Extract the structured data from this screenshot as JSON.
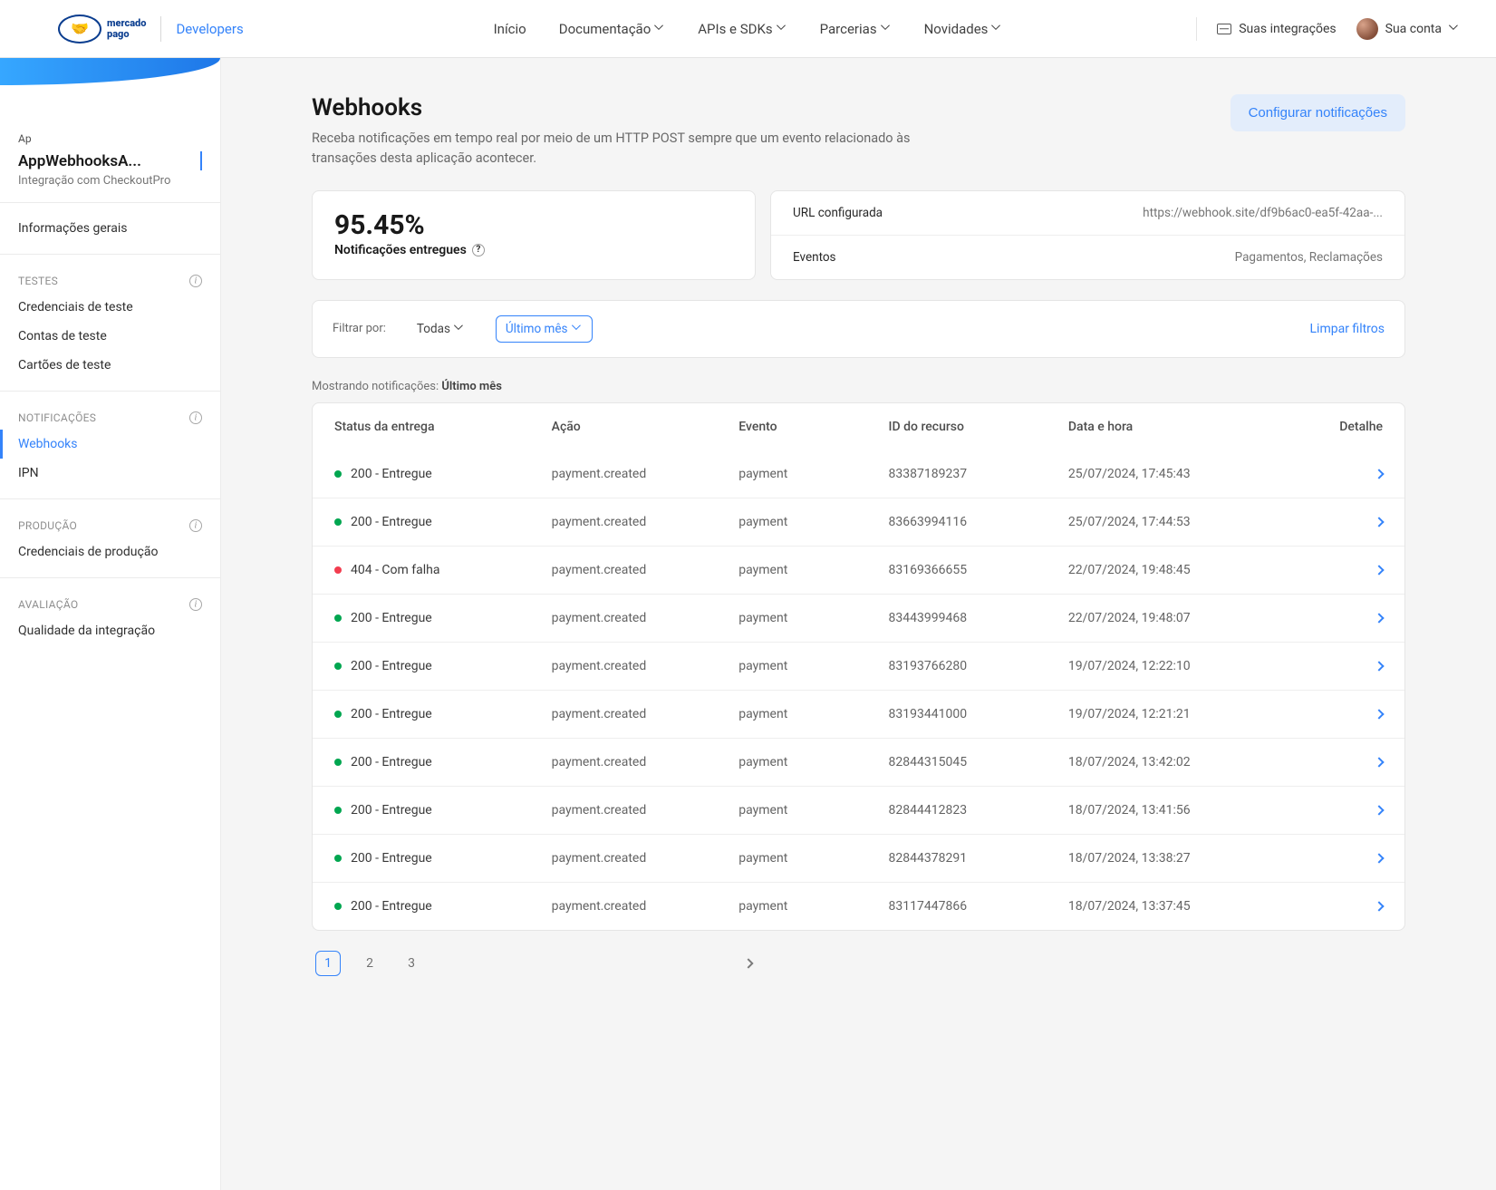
{
  "header": {
    "brand_main": "mercado pago",
    "brand_sub": "Developers",
    "nav": {
      "inicio": "Início",
      "documentacao": "Documentação",
      "apis": "APIs e SDKs",
      "parcerias": "Parcerias",
      "novidades": "Novidades"
    },
    "integrations_link": "Suas integrações",
    "account_label": "Sua conta"
  },
  "sidebar": {
    "breadcrumb": "Ap",
    "app_name": "AppWebhooksA...",
    "app_subtitle": "Integração com CheckoutPro",
    "general": "Informações gerais",
    "section_tests": "TESTES",
    "tests_items": {
      "cred": "Credenciais de teste",
      "accounts": "Contas de teste",
      "cards": "Cartões de teste"
    },
    "section_notif": "NOTIFICAÇÕES",
    "notif_items": {
      "webhooks": "Webhooks",
      "ipn": "IPN"
    },
    "section_prod": "PRODUÇÃO",
    "prod_items": {
      "cred": "Credenciais de produção"
    },
    "section_eval": "AVALIAÇÃO",
    "eval_items": {
      "quality": "Qualidade da integração"
    }
  },
  "page": {
    "title": "Webhooks",
    "description": "Receba notificações em tempo real por meio de um HTTP POST sempre que um evento relacionado às transações desta aplicação acontecer.",
    "config_btn": "Configurar notificações",
    "kpi_value": "95.45%",
    "kpi_label": "Notificações entregues",
    "info": {
      "url_label": "URL configurada",
      "url_value": "https://webhook.site/df9b6ac0-ea5f-42aa-...",
      "events_label": "Eventos",
      "events_value": "Pagamentos, Reclamações"
    },
    "filter": {
      "label": "Filtrar por:",
      "chip_all": "Todas",
      "chip_period": "Último mês",
      "clear": "Limpar filtros"
    },
    "showing_prefix": "Mostrando notificações: ",
    "showing_value": "Último mês",
    "columns": {
      "status": "Status da entrega",
      "action": "Ação",
      "event": "Evento",
      "resource": "ID do recurso",
      "datetime": "Data e hora",
      "detail": "Detalhe"
    },
    "rows": [
      {
        "status": "200 - Entregue",
        "ok": true,
        "action": "payment.created",
        "event": "payment",
        "resource": "83387189237",
        "datetime": "25/07/2024, 17:45:43"
      },
      {
        "status": "200 - Entregue",
        "ok": true,
        "action": "payment.created",
        "event": "payment",
        "resource": "83663994116",
        "datetime": "25/07/2024, 17:44:53"
      },
      {
        "status": "404 - Com falha",
        "ok": false,
        "action": "payment.created",
        "event": "payment",
        "resource": "83169366655",
        "datetime": "22/07/2024, 19:48:45"
      },
      {
        "status": "200 - Entregue",
        "ok": true,
        "action": "payment.created",
        "event": "payment",
        "resource": "83443999468",
        "datetime": "22/07/2024, 19:48:07"
      },
      {
        "status": "200 - Entregue",
        "ok": true,
        "action": "payment.created",
        "event": "payment",
        "resource": "83193766280",
        "datetime": "19/07/2024, 12:22:10"
      },
      {
        "status": "200 - Entregue",
        "ok": true,
        "action": "payment.created",
        "event": "payment",
        "resource": "83193441000",
        "datetime": "19/07/2024, 12:21:21"
      },
      {
        "status": "200 - Entregue",
        "ok": true,
        "action": "payment.created",
        "event": "payment",
        "resource": "82844315045",
        "datetime": "18/07/2024, 13:42:02"
      },
      {
        "status": "200 - Entregue",
        "ok": true,
        "action": "payment.created",
        "event": "payment",
        "resource": "82844412823",
        "datetime": "18/07/2024, 13:41:56"
      },
      {
        "status": "200 - Entregue",
        "ok": true,
        "action": "payment.created",
        "event": "payment",
        "resource": "82844378291",
        "datetime": "18/07/2024, 13:38:27"
      },
      {
        "status": "200 - Entregue",
        "ok": true,
        "action": "payment.created",
        "event": "payment",
        "resource": "83117447866",
        "datetime": "18/07/2024, 13:37:45"
      }
    ],
    "pagination": {
      "p1": "1",
      "p2": "2",
      "p3": "3"
    }
  }
}
